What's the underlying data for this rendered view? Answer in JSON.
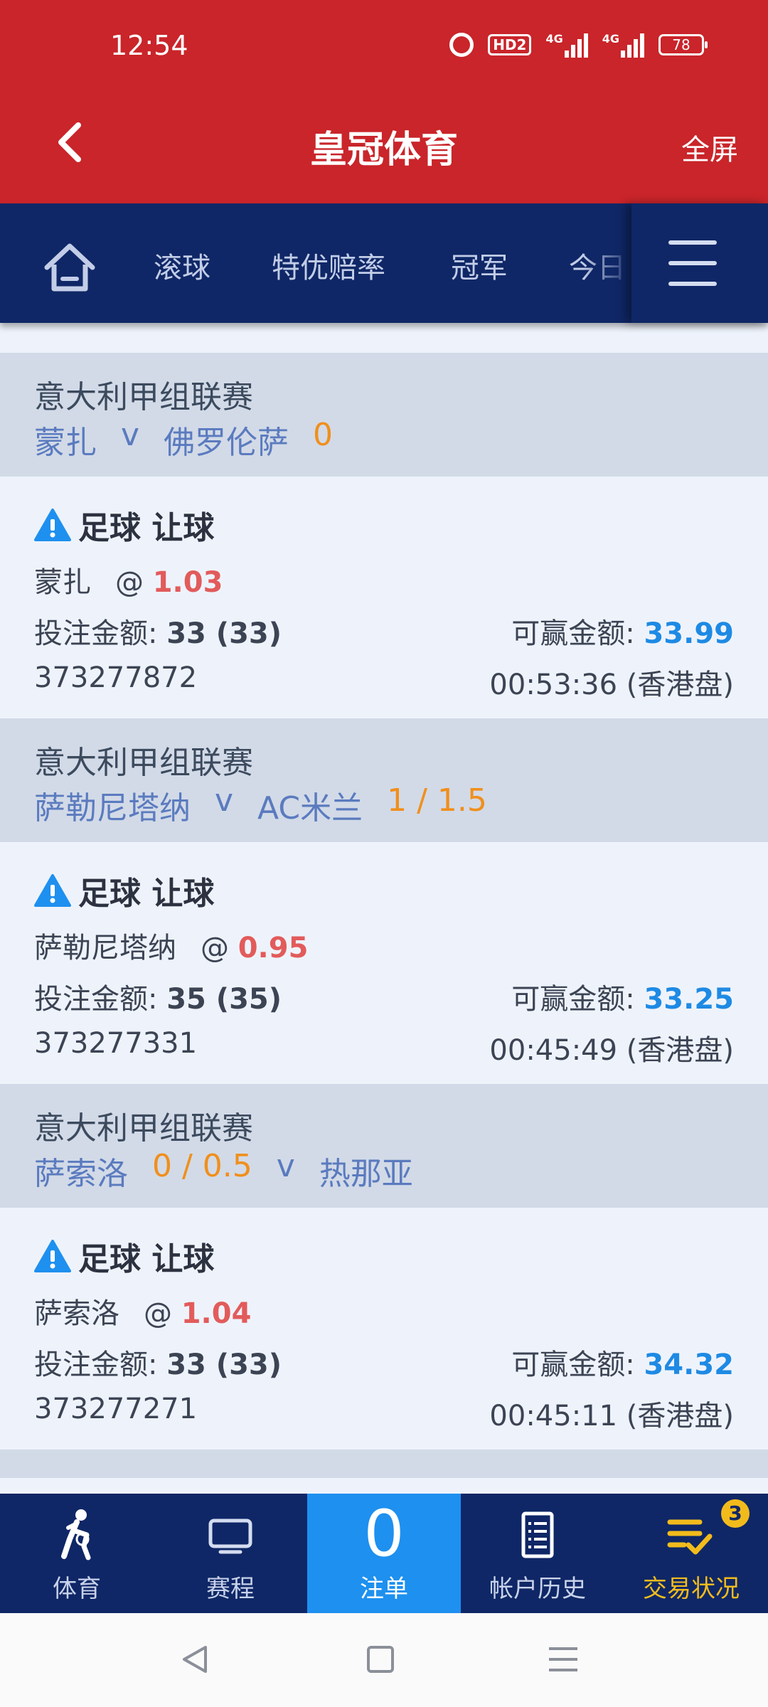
{
  "status_bar": {
    "time": "12:54",
    "network_1": "4G",
    "network_2": "4G",
    "hd_label": "HD2",
    "battery": "78"
  },
  "header": {
    "title": "皇冠体育",
    "fullscreen_label": "全屏",
    "bg_color": "#c9252a"
  },
  "nav": {
    "tabs": [
      "滚球",
      "特优赔率",
      "冠军",
      "今日"
    ]
  },
  "bets": [
    {
      "league": "意大利甲组联赛",
      "home": "蒙扎",
      "vs": "v",
      "away": "佛罗伦萨",
      "handicap": "0",
      "bet_type": "足球 让球",
      "pick": "蒙扎",
      "at": "@",
      "odds": "1.03",
      "stake_label": "投注金额:",
      "stake": "33 (33)",
      "win_label": "可赢金额:",
      "win": "33.99",
      "ticket_id": "373277872",
      "time": "00:53:36 (香港盘)"
    },
    {
      "league": "意大利甲组联赛",
      "home": "萨勒尼塔纳",
      "vs": "v",
      "away": "AC米兰",
      "handicap": "1 / 1.5",
      "bet_type": "足球 让球",
      "pick": "萨勒尼塔纳",
      "at": "@",
      "odds": "0.95",
      "stake_label": "投注金额:",
      "stake": "35 (35)",
      "win_label": "可赢金额:",
      "win": "33.25",
      "ticket_id": "373277331",
      "time": "00:45:49 (香港盘)"
    },
    {
      "league": "意大利甲组联赛",
      "home": "萨索洛",
      "handicap": "0 / 0.5",
      "vs": "v",
      "away": "热那亚",
      "bet_type": "足球 让球",
      "pick": "萨索洛",
      "at": "@",
      "odds": "1.04",
      "stake_label": "投注金额:",
      "stake": "33 (33)",
      "win_label": "可赢金额:",
      "win": "34.32",
      "ticket_id": "373277271",
      "time": "00:45:11 (香港盘)"
    }
  ],
  "bottom_tabs": [
    {
      "label": "体育",
      "icon": "sports-player-icon"
    },
    {
      "label": "赛程",
      "icon": "tv-icon"
    },
    {
      "label": "注单",
      "count": "0"
    },
    {
      "label": "帐户历史",
      "icon": "document-list-icon"
    },
    {
      "label": "交易状况",
      "icon": "checklist-icon",
      "badge": "3"
    }
  ],
  "colors": {
    "navy": "#0f2766",
    "accent_blue": "#1e90ef",
    "odds_red": "#e25b5b",
    "handicap_orange": "#f08f1c",
    "gold": "#f2bb1c"
  }
}
